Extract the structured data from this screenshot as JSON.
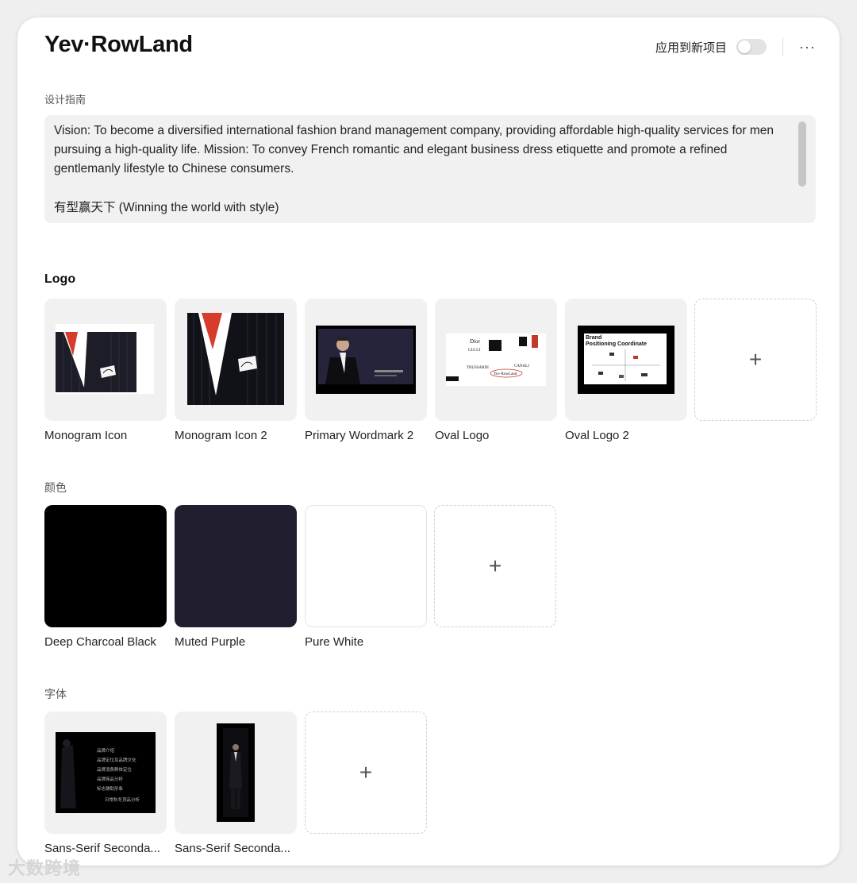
{
  "header": {
    "title": "Yev·RowLand",
    "apply_label": "应用到新项目",
    "more_label": "···"
  },
  "guide": {
    "label": "设计指南",
    "paragraph1": "Vision: To become a diversified international fashion brand management company, providing affordable high-quality services for men pursuing a high-quality life. Mission: To convey French romantic and elegant business dress etiquette and promote a refined gentlemanly lifestyle to Chinese consumers.",
    "paragraph2": "有型赢天下 (Winning the world with style)"
  },
  "logo": {
    "label": "Logo",
    "items": [
      {
        "name": "Monogram Icon"
      },
      {
        "name": "Monogram Icon 2"
      },
      {
        "name": "Primary Wordmark 2"
      },
      {
        "name": "Oval Logo"
      },
      {
        "name": "Oval Logo 2"
      }
    ],
    "add_label": "+"
  },
  "colors": {
    "label": "颜色",
    "items": [
      {
        "name": "Deep Charcoal Black",
        "hex": "#000000"
      },
      {
        "name": "Muted Purple",
        "hex": "#201e2f"
      },
      {
        "name": "Pure White",
        "hex": "#ffffff"
      }
    ],
    "add_label": "+"
  },
  "fonts": {
    "label": "字体",
    "items": [
      {
        "name": "Sans-Serif Seconda..."
      },
      {
        "name": "Sans-Serif Seconda..."
      }
    ],
    "add_label": "+"
  },
  "thumb_text": {
    "brand": "Brand",
    "positioning": "Positioning Coordinate",
    "oval_wordmark": "Yev·RowLand",
    "dior": "Dior",
    "gucci": "GUCCI",
    "trussardi": "TRUSSARDI",
    "canali": "CANALI",
    "menu_lines": [
      "品牌介绍",
      "品牌定位及品牌文化",
      "品牌消费群体定位",
      "品牌商品分析",
      "标志辅助形象",
      "日常秋冬顶品分析"
    ]
  },
  "watermark": "大数跨境"
}
